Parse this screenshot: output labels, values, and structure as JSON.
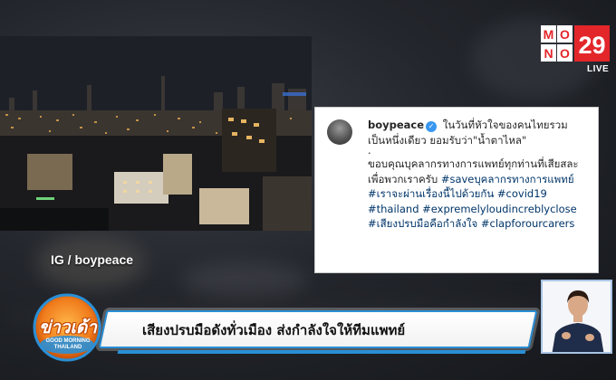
{
  "post": {
    "username": "boypeace",
    "line1": "ในวันที่หัวใจของคนไทยรวม",
    "line2": "เป็นหนึ่งเดียว ยอมรับว่า\"น้ำตาไหล\"",
    "dot": ".",
    "para2_text": "ขอบคุณบุคลากรทางการแพทย์ทุกท่านที่เสียสละเพื่อพวกเราครับ",
    "tag1": "#saveบุคลากรทางการแพทย์",
    "tag2": "#เราจะผ่านเรื่องนี้ไปด้วยกัน",
    "tag3": "#covid19",
    "tag4": "#thailand",
    "tag5": "#expremelyloudincreblyclose",
    "tag6": "#เสียงปรบมือคือกำลังใจ",
    "tag7": "#clapforourcarers"
  },
  "caption": "IG / boypeace",
  "headline": "เสียงปรบมือดังทั่วเมือง ส่งกำลังใจให้ทีมแพทย์",
  "channel": {
    "logo_mo_top": "MO",
    "logo_no_bottom": "NO",
    "logo_number": "29",
    "live": "LIVE"
  },
  "show": {
    "title": "ข่าวเด้า",
    "subtitle_1": "GOOD MORNING",
    "subtitle_2": "THAILAND"
  },
  "colors": {
    "accent_blue": "#2a8fd6",
    "logo_red": "#e3262a",
    "show_orange": "#f07c1c"
  }
}
